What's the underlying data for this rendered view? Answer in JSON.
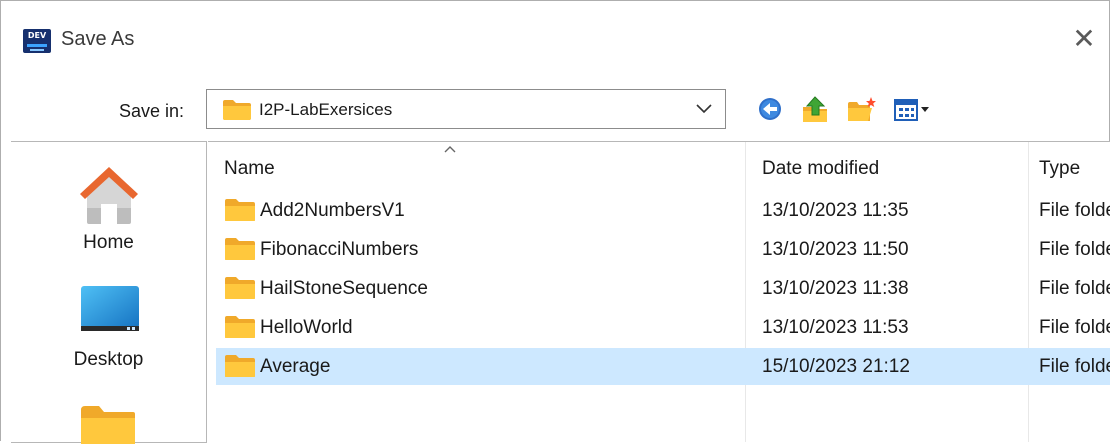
{
  "window": {
    "title": "Save As",
    "app_icon_text": "DEV",
    "close_glyph": "✕"
  },
  "save_in": {
    "label": "Save in:",
    "current_folder": "I2P-LabExersices"
  },
  "toolbar": {
    "buttons": [
      "back-icon",
      "up-one-level-icon",
      "new-folder-icon",
      "view-menu-icon"
    ]
  },
  "places": [
    {
      "label": "Home",
      "icon": "home-icon"
    },
    {
      "label": "Desktop",
      "icon": "desktop-icon"
    },
    {
      "label": "",
      "icon": "folder-icon"
    }
  ],
  "columns": {
    "name": "Name",
    "date_modified": "Date modified",
    "type": "Type"
  },
  "files": [
    {
      "name": "Add2NumbersV1",
      "date_modified": "13/10/2023 11:35",
      "type": "File folder",
      "selected": false
    },
    {
      "name": "FibonacciNumbers",
      "date_modified": "13/10/2023 11:50",
      "type": "File folder",
      "selected": false
    },
    {
      "name": "HailStoneSequence",
      "date_modified": "13/10/2023 11:38",
      "type": "File folder",
      "selected": false
    },
    {
      "name": "HelloWorld",
      "date_modified": "13/10/2023 11:53",
      "type": "File folder",
      "selected": false
    },
    {
      "name": "Average",
      "date_modified": "15/10/2023 21:12",
      "type": "File folder",
      "selected": true
    }
  ],
  "colors": {
    "selection": "#cde8ff",
    "folder": "#ffc83d",
    "folder_dark": "#f0a92a",
    "home_roof": "#e8672f",
    "desktop": "#1f8fd6"
  }
}
